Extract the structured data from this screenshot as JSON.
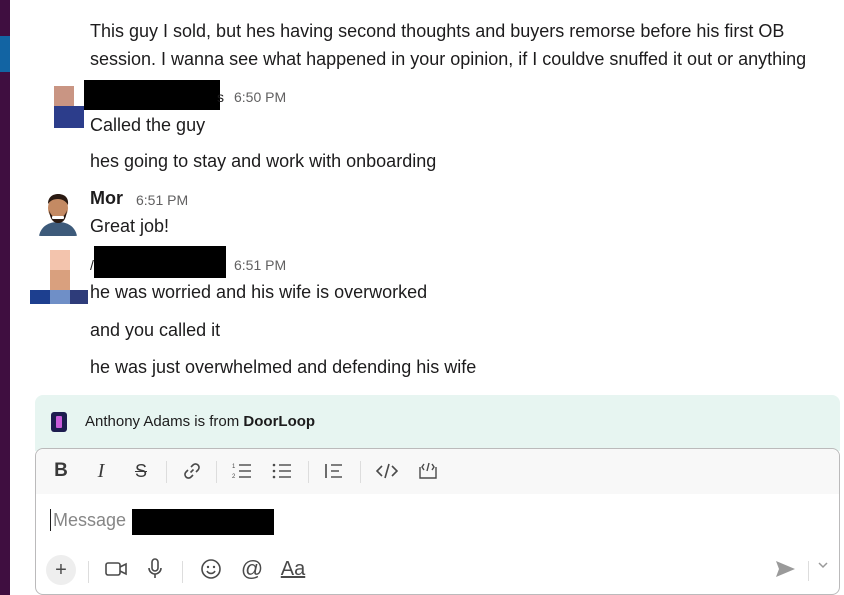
{
  "messages": {
    "block0": {
      "line1": "This guy I sold, but hes having second thoughts and buyers remorse before his first OB",
      "line2": "session. I wanna see what happened in your opinion, if I couldve snuffed it out or anything"
    },
    "block1": {
      "name_tail": "s",
      "time": "6:50 PM",
      "lines": [
        "Called the guy",
        "hes going to stay and work with onboarding"
      ]
    },
    "block2": {
      "name": "Mor",
      "time": "6:51 PM",
      "lines": [
        "Great job!"
      ]
    },
    "block3": {
      "name_head": "/",
      "time": "6:51 PM",
      "lines": [
        "he was worried and his wife is overworked",
        "and you called it",
        "he was just overwhelmed and defending his wife"
      ]
    }
  },
  "banner": {
    "prefix": "Anthony Adams is from ",
    "org": "DoorLoop"
  },
  "composer": {
    "placeholder": "Message ",
    "toolbar_icons": [
      "bold-icon",
      "italic-icon",
      "strikethrough-icon",
      "link-icon",
      "ordered-list-icon",
      "bulleted-list-icon",
      "blockquote-icon",
      "code-icon",
      "code-block-icon"
    ],
    "bottom_icons": [
      "plus-icon",
      "video-icon",
      "microphone-icon",
      "emoji-icon",
      "mention-icon",
      "formatting-icon",
      "send-icon",
      "chevron-down-icon"
    ],
    "formatting_label": "Aa",
    "mention_label": "@"
  },
  "colors": {
    "sidebar": "#3f0e40",
    "accent": "#1264a3",
    "banner_bg": "#e7f5f1"
  }
}
